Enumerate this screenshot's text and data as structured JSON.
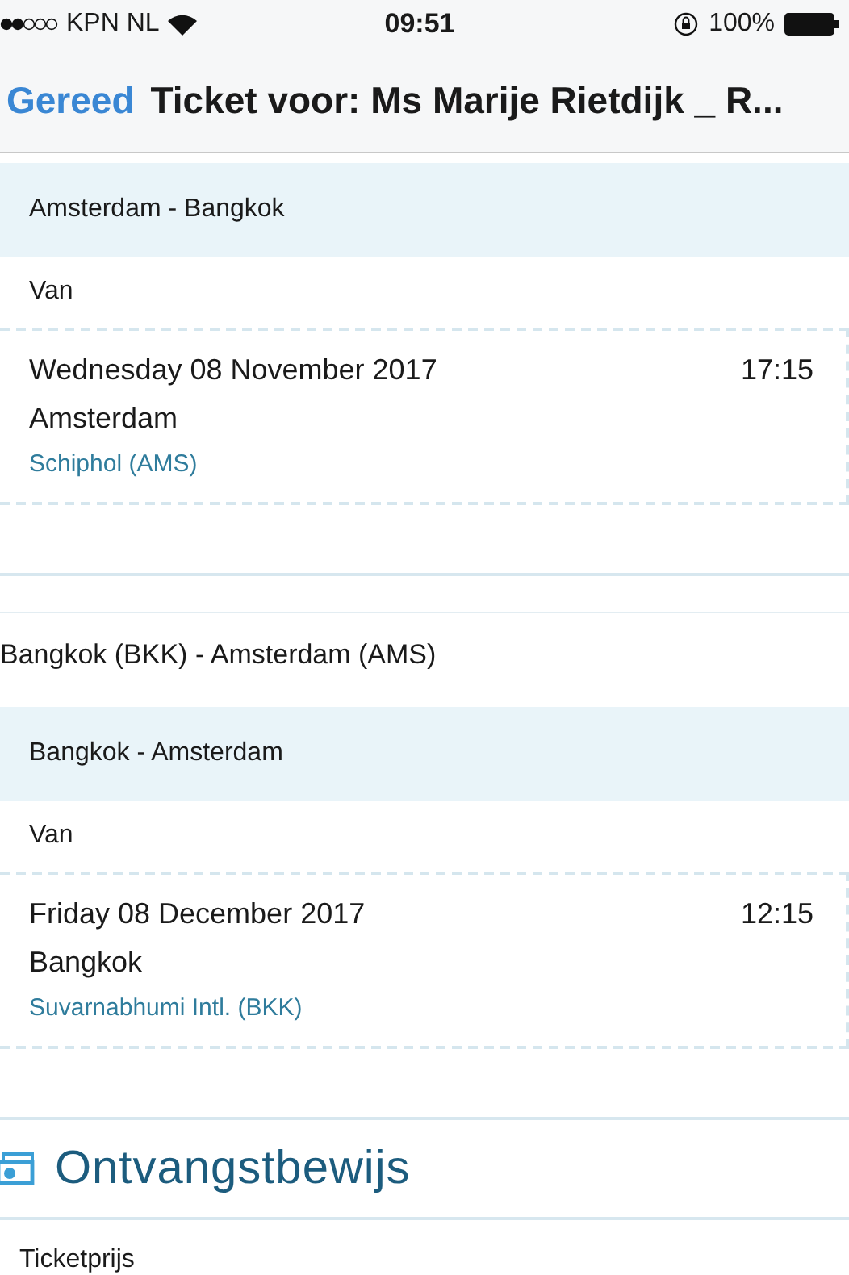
{
  "status_bar": {
    "carrier": "KPN NL",
    "time": "09:51",
    "battery": "100%"
  },
  "nav": {
    "back": "Gereed",
    "title": "Ticket voor: Ms Marije Rietdijk _ R..."
  },
  "legs": [
    {
      "band": "Amsterdam - Bangkok",
      "from_label": "Van",
      "date": "Wednesday 08 November 2017",
      "time": "17:15",
      "city": "Amsterdam",
      "airport": "Schiphol (AMS)"
    },
    {
      "route": "Bangkok (BKK) - Amsterdam (AMS)",
      "band": "Bangkok - Amsterdam",
      "from_label": "Van",
      "date": "Friday 08 December 2017",
      "time": "12:15",
      "city": "Bangkok",
      "airport": "Suvarnabhumi Intl. (BKK)"
    }
  ],
  "receipt": {
    "title": "Ontvangstbewijs",
    "rows": [
      "Ticketprijs"
    ]
  }
}
